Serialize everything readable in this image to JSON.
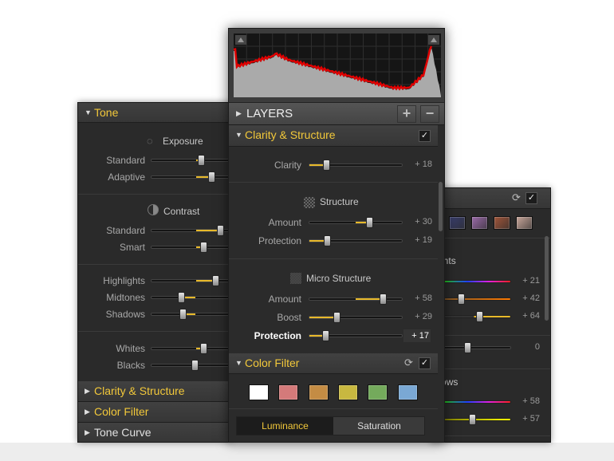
{
  "left": {
    "header": "Tone",
    "exposure": {
      "title": "Exposure",
      "rows": [
        {
          "label": "Standard",
          "value": 12
        },
        {
          "label": "Adaptive",
          "value": 36
        }
      ]
    },
    "contrast": {
      "title": "Contrast",
      "rows": [
        {
          "label": "Standard",
          "value": 55
        },
        {
          "label": "Smart",
          "value": 18
        }
      ]
    },
    "tones": [
      {
        "label": "Highlights",
        "value": 45
      },
      {
        "label": "Midtones",
        "value": -34
      },
      {
        "label": "Shadows",
        "value": -30
      }
    ],
    "wb": [
      {
        "label": "Whites",
        "value": 18
      },
      {
        "label": "Blacks",
        "value": -2
      }
    ],
    "collapsed": [
      "Clarity & Structure",
      "Color Filter",
      "Tone Curve"
    ]
  },
  "center": {
    "layers_label": "LAYERS",
    "add": "+",
    "remove": "−",
    "clarity_header": "Clarity & Structure",
    "check": "✓",
    "clarity": {
      "label": "Clarity",
      "value": 18,
      "display": "+ 18"
    },
    "structure": {
      "title": "Structure",
      "rows": [
        {
          "label": "Amount",
          "value": 30,
          "display": "+ 30",
          "bipolar": true
        },
        {
          "label": "Protection",
          "value": 19,
          "display": "+ 19",
          "bipolar": false
        }
      ]
    },
    "micro": {
      "title": "Micro Structure",
      "rows": [
        {
          "label": "Amount",
          "value": 58,
          "display": "+ 58",
          "bipolar": true
        },
        {
          "label": "Boost",
          "value": 29,
          "display": "+ 29",
          "bipolar": false
        },
        {
          "label": "Protection",
          "value": 17,
          "display": "+ 17",
          "bipolar": false
        }
      ]
    },
    "color_filter_header": "Color Filter",
    "swatches": [
      "#ffffff",
      "#d47a7a",
      "#c48c44",
      "#c8b840",
      "#74aa5c",
      "#7aa8d4"
    ],
    "tabs": [
      "Luminance",
      "Saturation"
    ],
    "active_tab": 0
  },
  "right": {
    "swatches": [
      "#3a3f6e",
      "#9a6aa8",
      "#a0553a",
      "#c8a69a"
    ],
    "highlights_title": "Highlights",
    "rows": [
      {
        "display": "+ 21",
        "pos": null,
        "kind": "rainbow"
      },
      {
        "display": "+ 42",
        "pos": 0.43,
        "kind": "orange"
      },
      {
        "display": "+ 64",
        "pos": 0.64,
        "kind": "yellow"
      }
    ],
    "mid": {
      "display": "0",
      "pos": 0.5
    },
    "shadows_title": "Shadows",
    "srows": [
      {
        "display": "+ 58",
        "pos": null,
        "kind": "rainbow"
      },
      {
        "display": "+ 57",
        "pos": 0.56,
        "kind": "yellowbright"
      }
    ]
  },
  "colors": {
    "accent": "#f2c83a"
  }
}
